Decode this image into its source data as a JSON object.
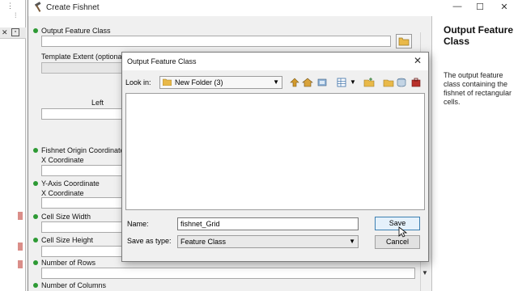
{
  "window": {
    "title": "Create Fishnet",
    "minimize": "—",
    "maximize": "☐",
    "close": "✕"
  },
  "form": {
    "output_feature_class": "Output Feature Class",
    "template_extent": "Template Extent (optional)",
    "left": "Left",
    "fishnet_origin": "Fishnet Origin Coordinate",
    "x_coordinate_1": "X Coordinate",
    "y_axis": "Y-Axis Coordinate",
    "x_coordinate_2": "X Coordinate",
    "cell_size_width": "Cell Size Width",
    "cell_size_height": "Cell Size Height",
    "number_of_rows": "Number of Rows",
    "number_of_columns": "Number of Columns"
  },
  "help": {
    "title": "Output Feature Class",
    "description": "The output feature class containing the fishnet of rectangular cells."
  },
  "dialog": {
    "title": "Output Feature Class",
    "look_in_label": "Look in:",
    "look_in_value": "New Folder (3)",
    "name_label": "Name:",
    "name_value": "fishnet_Grid",
    "save_as_type_label": "Save as type:",
    "save_as_type_value": "Feature Class",
    "save_button": "Save",
    "cancel_button": "Cancel",
    "close": "✕"
  },
  "colors": {
    "required_dot": "#2d9a34",
    "accent": "#3c7fb1"
  }
}
